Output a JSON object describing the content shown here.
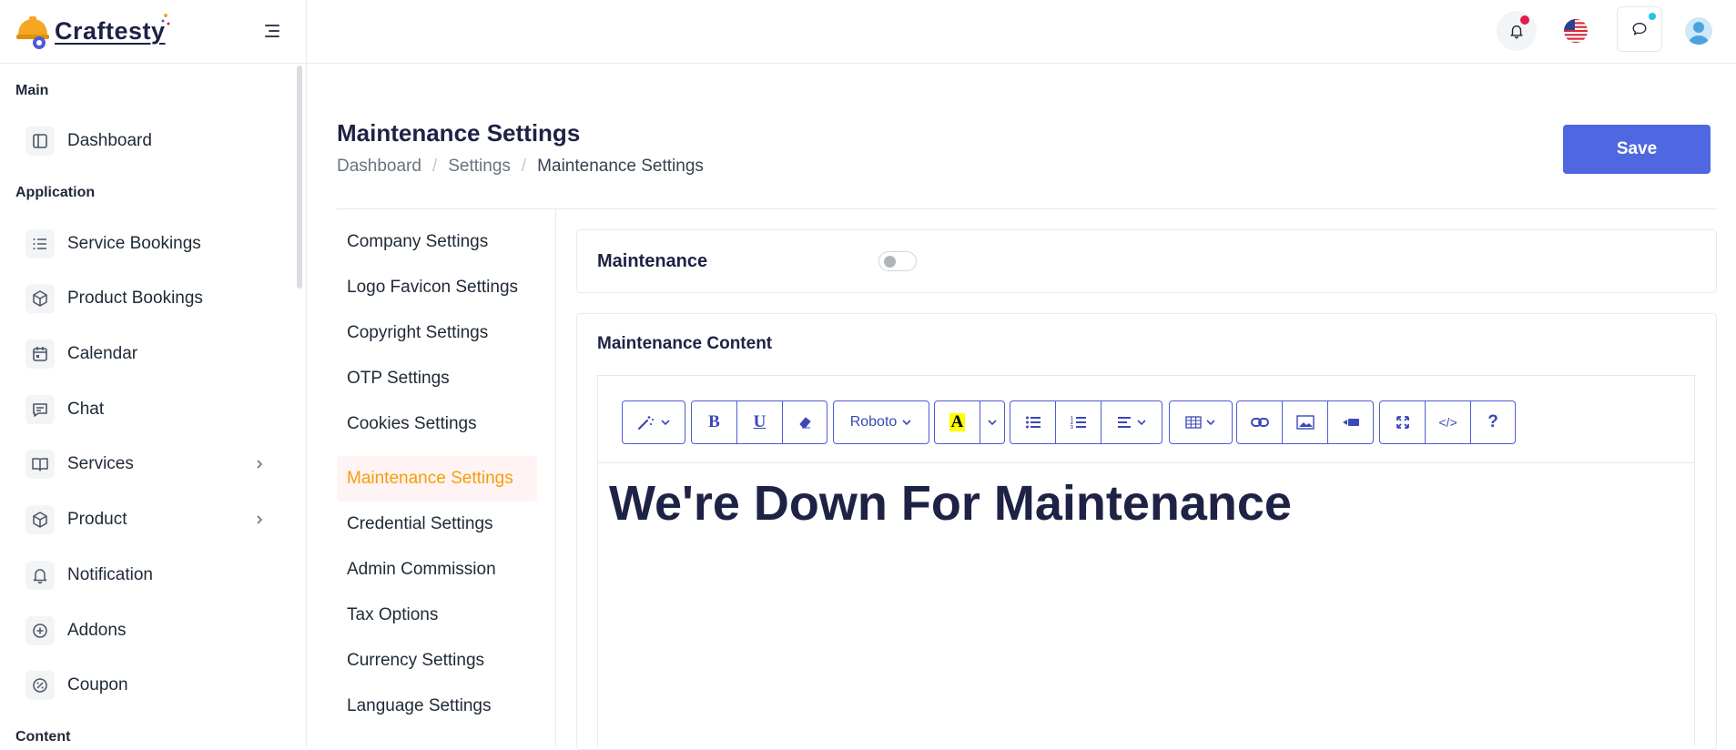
{
  "brand": {
    "name": "Craftesty"
  },
  "sidebar": {
    "sections": [
      "Main",
      "Application",
      "Content"
    ],
    "items": [
      {
        "label": "Dashboard",
        "icon": "layout-icon"
      },
      {
        "label": "Service Bookings",
        "icon": "list-icon"
      },
      {
        "label": "Product Bookings",
        "icon": "box-icon"
      },
      {
        "label": "Calendar",
        "icon": "calendar-icon"
      },
      {
        "label": "Chat",
        "icon": "message-icon"
      },
      {
        "label": "Services",
        "icon": "book-icon"
      },
      {
        "label": "Product",
        "icon": "box-icon"
      },
      {
        "label": "Notification",
        "icon": "bell-icon"
      },
      {
        "label": "Addons",
        "icon": "plus-circle-icon"
      },
      {
        "label": "Coupon",
        "icon": "percent-icon"
      }
    ]
  },
  "page": {
    "title": "Maintenance Settings",
    "breadcrumb": [
      "Dashboard",
      "Settings",
      "Maintenance Settings"
    ],
    "save_label": "Save"
  },
  "settings_menu": [
    "Company Settings",
    "Logo Favicon Settings",
    "Copyright Settings",
    "OTP Settings",
    "Cookies Settings",
    "Maintenance Settings",
    "Credential Settings",
    "Admin Commission",
    "Tax Options",
    "Currency Settings",
    "Language Settings"
  ],
  "settings_active": "Maintenance Settings",
  "maintenance": {
    "label": "Maintenance",
    "enabled": false,
    "content_label": "Maintenance Content"
  },
  "editor": {
    "font_name": "Roboto",
    "content_heading": "We're Down For Maintenance"
  },
  "colors": {
    "accent": "#4f67e0",
    "active_menu_text": "#f59e0b",
    "active_menu_bg": "#fff3f3",
    "notification_dot": "#e11d48",
    "chat_dot": "#22c3e6"
  }
}
